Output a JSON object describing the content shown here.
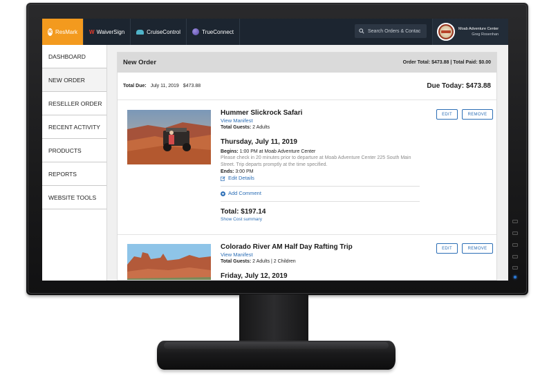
{
  "topbar": {
    "brands": [
      {
        "label": "ResMark",
        "icon": "resmark-logo-icon"
      },
      {
        "label": "WaiverSign",
        "icon": "waiversign-logo-icon"
      },
      {
        "label": "CruiseControl",
        "icon": "cruisecontrol-logo-icon"
      },
      {
        "label": "TrueConnect",
        "icon": "trueconnect-logo-icon"
      }
    ],
    "search_placeholder": "Search Orders & Contac",
    "account": {
      "company": "Moab Adventure Center",
      "user": "Greg Rosenhan"
    }
  },
  "sidebar": {
    "items": [
      {
        "label": "DASHBOARD"
      },
      {
        "label": "NEW ORDER"
      },
      {
        "label": "RESELLER ORDER"
      },
      {
        "label": "RECENT ACTIVITY"
      },
      {
        "label": "PRODUCTS"
      },
      {
        "label": "REPORTS"
      },
      {
        "label": "WEBSITE TOOLS"
      }
    ]
  },
  "order": {
    "title": "New Order",
    "totals": "Order Total: $473.88 | Total Paid: $0.00",
    "total_due_label": "Total Due:",
    "total_due_date": "July 11, 2019",
    "total_due_amount": "$473.88",
    "due_today": "Due Today: $473.88"
  },
  "trips": [
    {
      "name": "Hummer Slickrock Safari",
      "manifest_link": "View Manifest",
      "guests_label": "Total Guests:",
      "guests": "2 Adults",
      "date": "Thursday, July 11, 2019",
      "begins_label": "Begins:",
      "begins": "1:00 PM at Moab Adventure Center",
      "description": "Please check in 20 minutes prior to departure at Moab Adventure Center 225 South Main Street. Trip departs promptly at the time specified.",
      "ends_label": "Ends:",
      "ends": "3:00 PM",
      "edit_details": "Edit Details",
      "add_comment": "Add Comment",
      "total": "Total: $197.14",
      "cost_summary": "Show Cost summary",
      "edit_label": "EDIT",
      "remove_label": "REMOVE"
    },
    {
      "name": "Colorado River AM Half Day Rafting Trip",
      "manifest_link": "View Manifest",
      "guests_label": "Total Guests:",
      "guests": "2 Adults | 2 Children",
      "date": "Friday, July 12, 2019",
      "edit_label": "EDIT",
      "remove_label": "REMOVE"
    }
  ],
  "colors": {
    "accent": "#f39a1e",
    "topbar": "#1c2530",
    "link": "#2a6db5"
  }
}
